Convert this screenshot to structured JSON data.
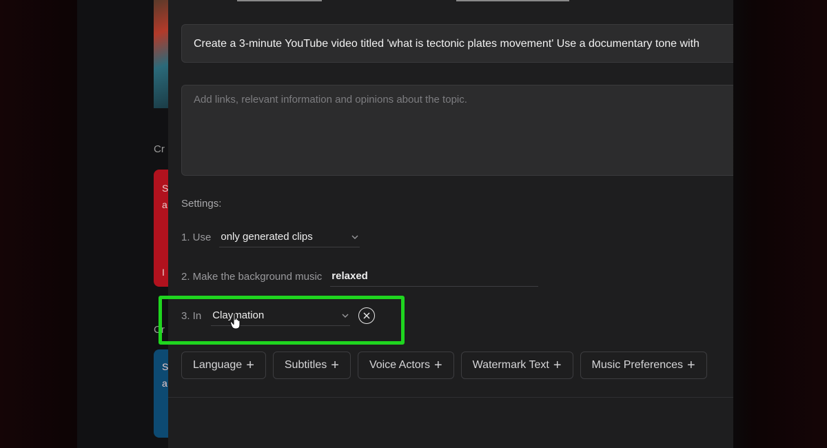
{
  "background": {
    "card_red_lines": [
      "S",
      "a",
      "I"
    ],
    "card_blue_lines": [
      "S",
      "a"
    ],
    "label_top": "Cr",
    "label_bottom": "Cr"
  },
  "prompt": {
    "text": "Create a 3-minute YouTube video titled 'what is tectonic plates movement' Use a documentary tone with"
  },
  "info": {
    "placeholder": "Add links, relevant information and opinions about the topic."
  },
  "settings": {
    "title": "Settings:",
    "row1": {
      "label": "1. Use",
      "value": "only generated clips"
    },
    "row2": {
      "label": "2. Make the background music",
      "value": "relaxed"
    },
    "row3": {
      "label": "3. In",
      "value": "Claymation"
    }
  },
  "chips": [
    {
      "label": "Language"
    },
    {
      "label": "Subtitles"
    },
    {
      "label": "Voice Actors"
    },
    {
      "label": "Watermark Text"
    },
    {
      "label": "Music Preferences"
    }
  ],
  "colors": {
    "highlight": "#1fd51f",
    "modal_bg": "#1e1e1f",
    "accent_red": "#b1121e",
    "accent_blue": "#0d4a72"
  },
  "icons": {
    "dropdown": "chevron-down-icon",
    "remove": "close-circle-icon",
    "add": "plus-icon",
    "pointer": "hand-pointer-cursor-icon"
  }
}
